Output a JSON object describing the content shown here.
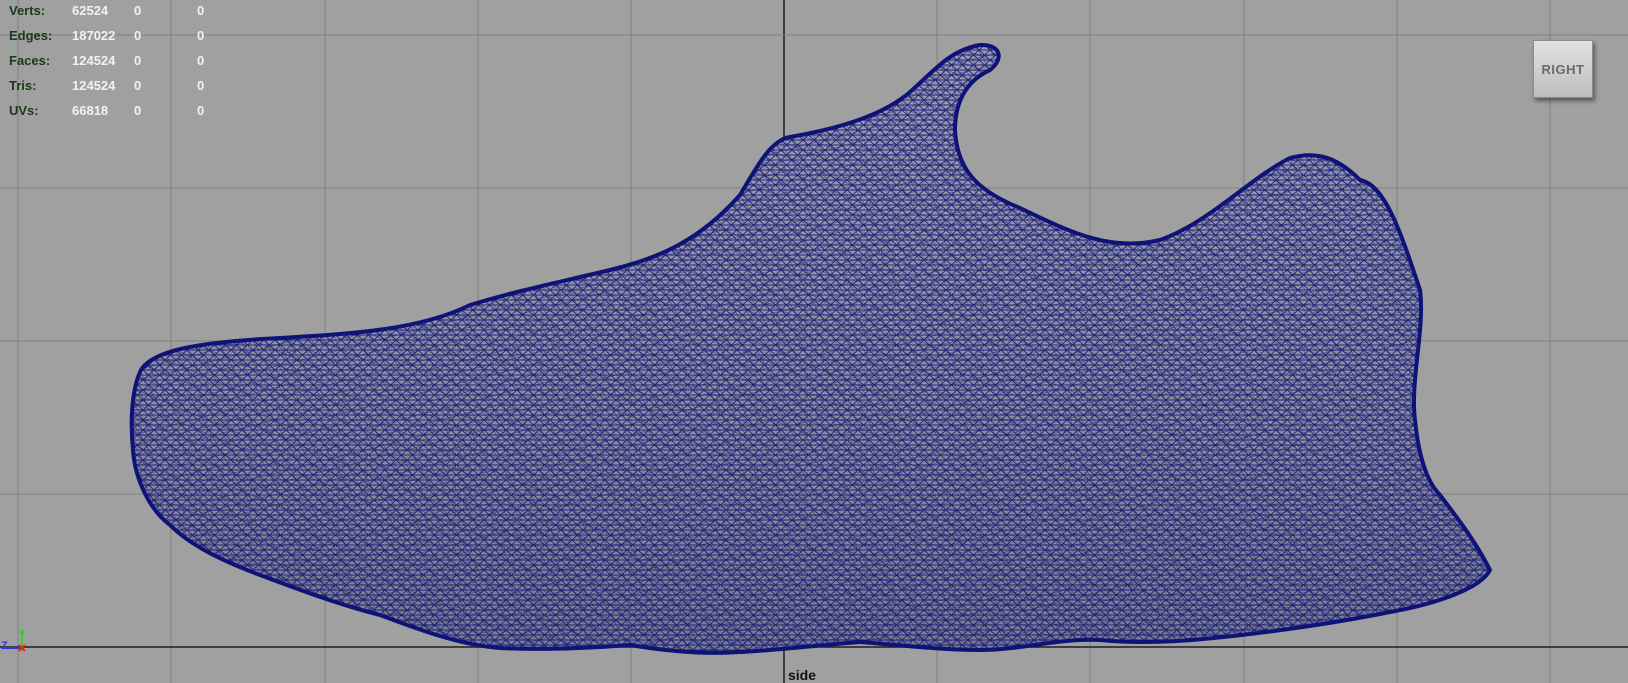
{
  "hud": {
    "rows": [
      {
        "label": "Verts:",
        "v1": "62524",
        "v2": "0",
        "v3": "0"
      },
      {
        "label": "Edges:",
        "v1": "187022",
        "v2": "0",
        "v3": "0"
      },
      {
        "label": "Faces:",
        "v1": "124524",
        "v2": "0",
        "v3": "0"
      },
      {
        "label": "Tris:",
        "v1": "124524",
        "v2": "0",
        "v3": "0"
      },
      {
        "label": "UVs:",
        "v1": "66818",
        "v2": "0",
        "v3": "0"
      }
    ]
  },
  "camera_label": "side",
  "view_cube_label": "RIGHT",
  "axis": {
    "y": "Y",
    "z": "Z",
    "x": "X"
  },
  "colors": {
    "background": "#a0a0a0",
    "grid": "#7f7f7f",
    "axis_line": "#1e1e1e",
    "mesh_fill": "#8d8f9d",
    "wireframe": "#0e1378",
    "label_green": "#1a3a1a",
    "axis_x": "#d62a1a",
    "axis_y": "#33cc33",
    "axis_z": "#2a3adf"
  }
}
